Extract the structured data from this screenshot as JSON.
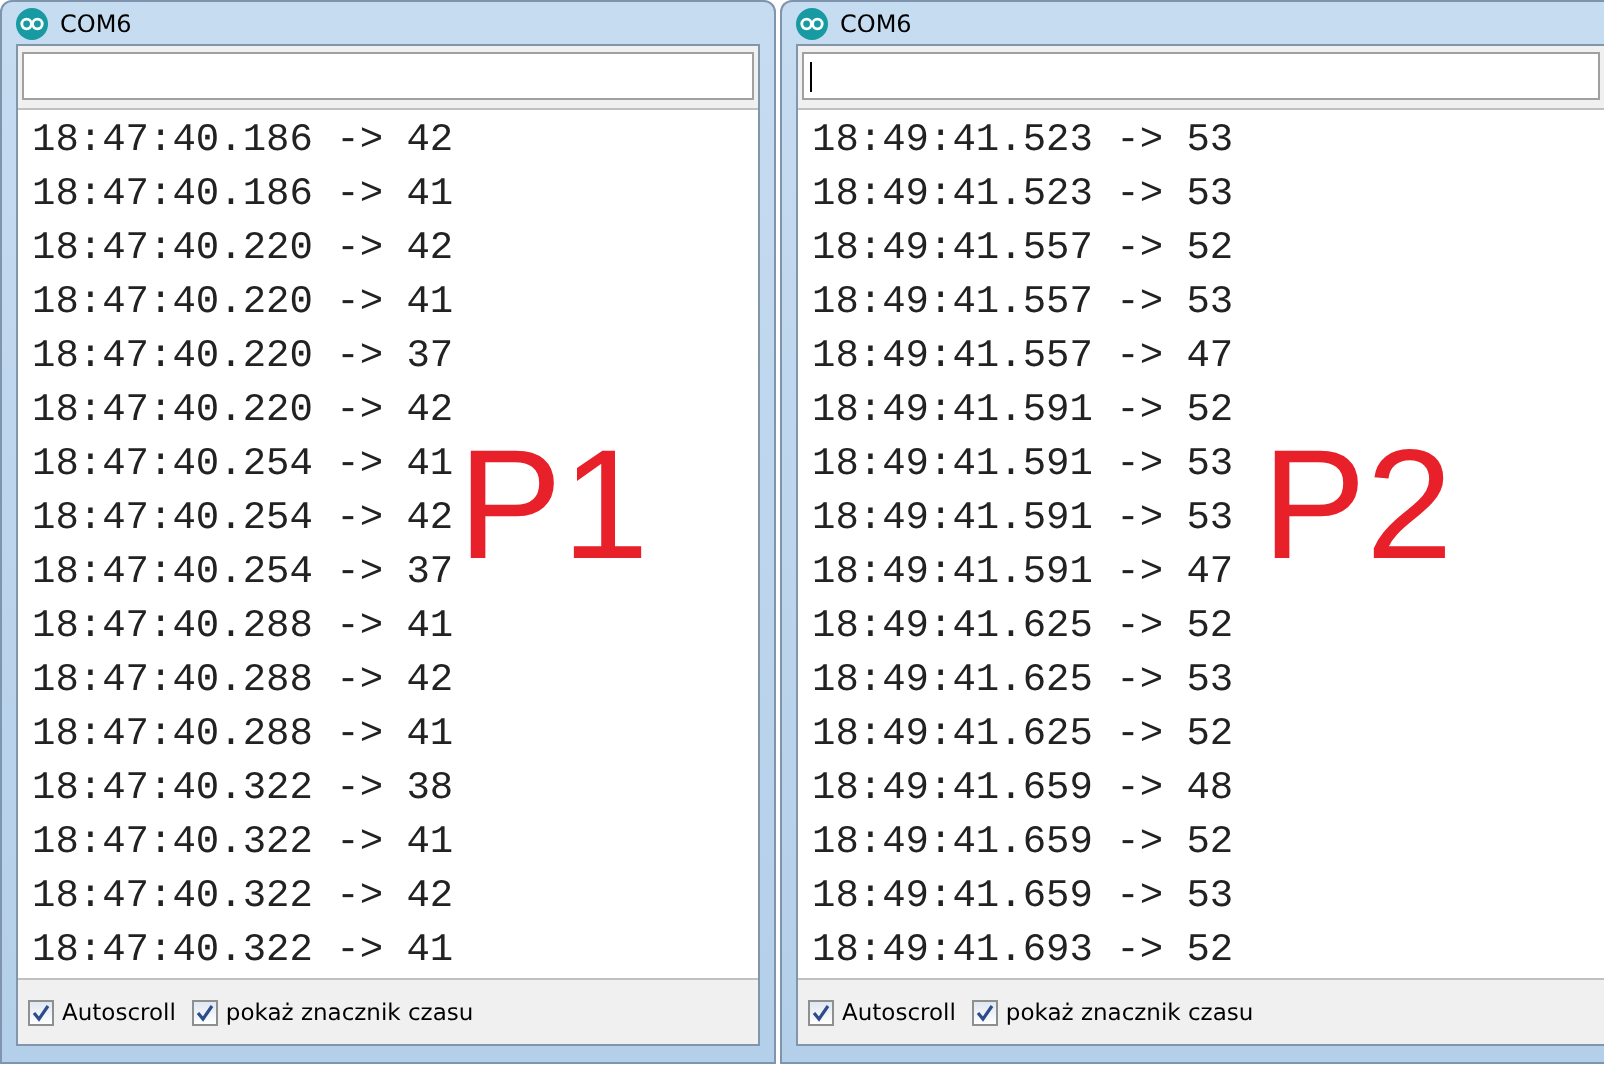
{
  "windows": [
    {
      "title": "COM6",
      "input": {
        "focused": false
      },
      "annotation": "P1",
      "lines": [
        "18:47:40.186 -> 42",
        "18:47:40.186 -> 41",
        "18:47:40.220 -> 42",
        "18:47:40.220 -> 41",
        "18:47:40.220 -> 37",
        "18:47:40.220 -> 42",
        "18:47:40.254 -> 41",
        "18:47:40.254 -> 42",
        "18:47:40.254 -> 37",
        "18:47:40.288 -> 41",
        "18:47:40.288 -> 42",
        "18:47:40.288 -> 41",
        "18:47:40.322 -> 38",
        "18:47:40.322 -> 41",
        "18:47:40.322 -> 42",
        "18:47:40.322 -> 41"
      ],
      "options": [
        {
          "label": "Autoscroll",
          "checked": true
        },
        {
          "label": "pokaż znacznik czasu",
          "checked": true
        }
      ]
    },
    {
      "title": "COM6",
      "input": {
        "focused": true
      },
      "annotation": "P2",
      "lines": [
        "18:49:41.523 -> 53",
        "18:49:41.523 -> 53",
        "18:49:41.557 -> 52",
        "18:49:41.557 -> 53",
        "18:49:41.557 -> 47",
        "18:49:41.591 -> 52",
        "18:49:41.591 -> 53",
        "18:49:41.591 -> 53",
        "18:49:41.591 -> 47",
        "18:49:41.625 -> 52",
        "18:49:41.625 -> 53",
        "18:49:41.625 -> 52",
        "18:49:41.659 -> 48",
        "18:49:41.659 -> 52",
        "18:49:41.659 -> 53",
        "18:49:41.693 -> 52"
      ],
      "options": [
        {
          "label": "Autoscroll",
          "checked": true
        },
        {
          "label": "pokaż znacznik czasu",
          "checked": true
        }
      ]
    }
  ]
}
